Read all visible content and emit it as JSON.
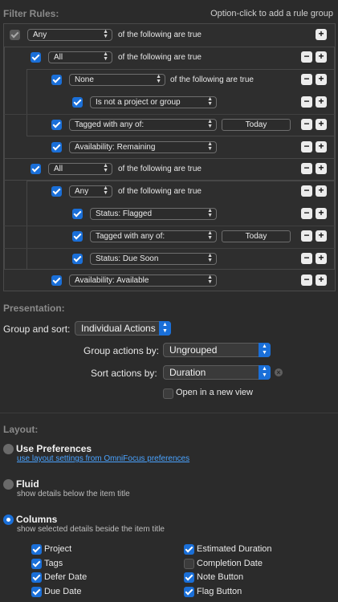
{
  "filter_rules": {
    "title": "Filter Rules:",
    "hint": "Option-click to add a rule group",
    "rows": [
      {
        "checked": true,
        "enabled": false,
        "popup": "Any",
        "text": "of the following are true",
        "minus": false
      },
      {
        "checked": true,
        "popup": "All",
        "text": "of the following are true",
        "minus": true
      },
      {
        "checked": true,
        "popup": "None",
        "text": "of the following are true",
        "minus": true
      },
      {
        "checked": true,
        "popup": "Is not a project or group",
        "minus": true
      },
      {
        "checked": true,
        "popup": "Tagged with any of:",
        "field": "Today",
        "minus": true
      },
      {
        "checked": true,
        "popup": "Availability: Remaining",
        "minus": true
      },
      {
        "checked": true,
        "popup": "All",
        "text": "of the following are true",
        "minus": true
      },
      {
        "checked": true,
        "popup": "Any",
        "text": "of the following are true",
        "minus": true
      },
      {
        "checked": true,
        "popup": "Status: Flagged",
        "minus": true
      },
      {
        "checked": true,
        "popup": "Tagged with any of:",
        "field": "Today",
        "minus": true
      },
      {
        "checked": true,
        "popup": "Status: Due Soon",
        "minus": true
      },
      {
        "checked": true,
        "popup": "Availability: Available",
        "minus": true
      }
    ],
    "minus_symbol": "−",
    "plus_symbol": "+"
  },
  "presentation": {
    "title": "Presentation:",
    "group_and_sort_label": "Group and sort:",
    "group_and_sort_value": "Individual Actions",
    "group_actions_label": "Group actions by:",
    "group_actions_value": "Ungrouped",
    "sort_actions_label": "Sort actions by:",
    "sort_actions_value": "Duration",
    "open_new_view_label": "Open in a new view",
    "open_new_view_checked": false
  },
  "layout": {
    "title": "Layout:",
    "options": [
      {
        "title": "Use Preferences",
        "subtitle": "use layout settings from OmniFocus preferences",
        "selected": false,
        "subtitle_is_link": true
      },
      {
        "title": "Fluid",
        "subtitle": "show details below the item title",
        "selected": false
      },
      {
        "title": "Columns",
        "subtitle": "show selected details beside the item title",
        "selected": true
      }
    ],
    "columns_left": [
      {
        "label": "Project",
        "checked": true
      },
      {
        "label": "Tags",
        "checked": true
      },
      {
        "label": "Defer Date",
        "checked": true
      },
      {
        "label": "Due Date",
        "checked": true
      }
    ],
    "columns_right": [
      {
        "label": "Estimated Duration",
        "checked": true
      },
      {
        "label": "Completion Date",
        "checked": false
      },
      {
        "label": "Note Button",
        "checked": true
      },
      {
        "label": "Flag Button",
        "checked": true
      }
    ]
  },
  "colors": {
    "background": "#2b2b2b",
    "accent": "#1a6fd8",
    "link": "#4aa3ff"
  },
  "icons": {
    "popup_arrows": "▲▼",
    "clear": "×"
  }
}
